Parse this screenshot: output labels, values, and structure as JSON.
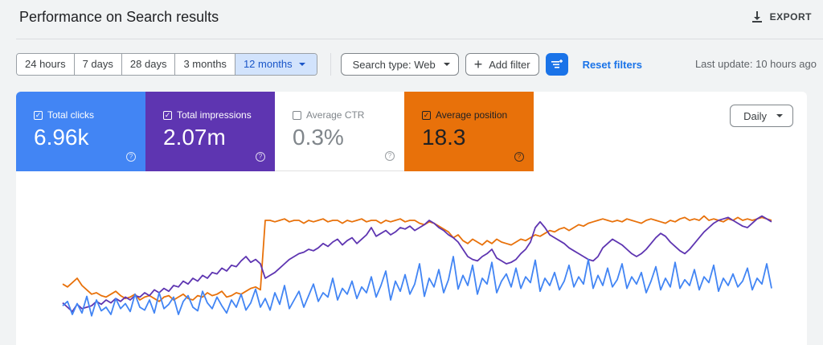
{
  "header": {
    "title": "Performance on Search results",
    "export_label": "EXPORT"
  },
  "toolbar": {
    "ranges": [
      "24 hours",
      "7 days",
      "28 days",
      "3 months",
      "12 months"
    ],
    "active_range": "12 months",
    "search_type": "Search type: Web",
    "add_filter": "Add filter",
    "reset": "Reset filters",
    "last_update": "Last update: 10 hours ago"
  },
  "metrics": [
    {
      "label": "Total clicks",
      "value": "6.96k",
      "checked": true,
      "color": "#4285f4"
    },
    {
      "label": "Total impressions",
      "value": "2.07m",
      "checked": true,
      "color": "#5e35b1"
    },
    {
      "label": "Average CTR",
      "value": "0.3%",
      "checked": false,
      "color": "#80868b"
    },
    {
      "label": "Average position",
      "value": "18.3",
      "checked": true,
      "color": "#e8710a"
    }
  ],
  "granularity": "Daily",
  "chart_data": {
    "type": "line",
    "series": [
      {
        "name": "Total clicks",
        "color": "#4285f4",
        "values": [
          32,
          38,
          20,
          35,
          22,
          45,
          18,
          40,
          25,
          30,
          20,
          42,
          28,
          35,
          24,
          48,
          30,
          26,
          40,
          22,
          50,
          28,
          34,
          44,
          20,
          38,
          46,
          30,
          25,
          52,
          36,
          28,
          44,
          32,
          22,
          40,
          30,
          48,
          26,
          36,
          55,
          30,
          42,
          26,
          50,
          34,
          60,
          28,
          40,
          52,
          30,
          46,
          62,
          38,
          50,
          44,
          70,
          40,
          56,
          48,
          66,
          42,
          58,
          50,
          72,
          44,
          60,
          80,
          40,
          66,
          52,
          75,
          48,
          62,
          90,
          45,
          70,
          58,
          82,
          50,
          68,
          100,
          55,
          74,
          60,
          88,
          48,
          70,
          62,
          92,
          50,
          66,
          76,
          58,
          84,
          56,
          72,
          64,
          95,
          52,
          70,
          60,
          78,
          54,
          66,
          88,
          58,
          72,
          62,
          96,
          56,
          74,
          60,
          84,
          58,
          68,
          90,
          56,
          72,
          62,
          78,
          50,
          66,
          86,
          54,
          70,
          58,
          92,
          56,
          68,
          60,
          82,
          54,
          72,
          64,
          88,
          52,
          70,
          60,
          76,
          58,
          66,
          84,
          54,
          70,
          62,
          90,
          56
        ]
      },
      {
        "name": "Total impressions",
        "color": "#5e35b1",
        "values": [
          36,
          30,
          24,
          34,
          28,
          30,
          32,
          38,
          34,
          40,
          36,
          42,
          38,
          44,
          40,
          46,
          44,
          50,
          46,
          54,
          50,
          56,
          52,
          60,
          58,
          66,
          62,
          70,
          66,
          74,
          70,
          78,
          76,
          84,
          80,
          88,
          86,
          94,
          100,
          92,
          96,
          90,
          70,
          74,
          78,
          84,
          90,
          96,
          100,
          104,
          106,
          110,
          108,
          112,
          118,
          114,
          120,
          124,
          116,
          122,
          126,
          118,
          124,
          130,
          140,
          128,
          132,
          136,
          130,
          134,
          140,
          138,
          142,
          136,
          140,
          144,
          150,
          146,
          140,
          136,
          130,
          126,
          120,
          110,
          100,
          96,
          94,
          100,
          104,
          110,
          98,
          94,
          90,
          92,
          96,
          104,
          110,
          120,
          140,
          148,
          140,
          130,
          126,
          122,
          118,
          112,
          108,
          104,
          100,
          96,
          94,
          100,
          112,
          118,
          124,
          120,
          116,
          110,
          104,
          100,
          104,
          110,
          118,
          126,
          132,
          128,
          120,
          114,
          108,
          104,
          110,
          118,
          126,
          134,
          140,
          146,
          150,
          152,
          154,
          150,
          146,
          142,
          140,
          146,
          152,
          156,
          152,
          148
        ]
      },
      {
        "name": "Average position",
        "color": "#e8710a",
        "values": [
          62,
          58,
          64,
          70,
          60,
          54,
          48,
          50,
          46,
          44,
          48,
          52,
          46,
          42,
          44,
          48,
          40,
          44,
          46,
          42,
          38,
          44,
          46,
          40,
          44,
          48,
          42,
          40,
          46,
          44,
          50,
          46,
          48,
          52,
          44,
          46,
          50,
          48,
          52,
          56,
          58,
          54,
          150,
          150,
          148,
          150,
          152,
          148,
          150,
          150,
          146,
          150,
          148,
          150,
          152,
          148,
          150,
          150,
          146,
          150,
          148,
          150,
          152,
          148,
          150,
          150,
          146,
          150,
          148,
          150,
          152,
          148,
          150,
          150,
          146,
          144,
          148,
          146,
          142,
          138,
          134,
          126,
          130,
          122,
          118,
          124,
          120,
          116,
          122,
          118,
          124,
          120,
          118,
          116,
          120,
          124,
          122,
          126,
          130,
          128,
          132,
          136,
          134,
          138,
          140,
          136,
          140,
          144,
          142,
          146,
          148,
          150,
          152,
          150,
          148,
          150,
          148,
          152,
          150,
          148,
          146,
          150,
          152,
          150,
          148,
          146,
          150,
          148,
          152,
          154,
          150,
          152,
          150,
          156,
          150,
          152,
          150,
          148,
          152,
          150,
          154,
          150,
          152,
          150,
          152,
          154,
          152,
          150
        ]
      }
    ]
  }
}
